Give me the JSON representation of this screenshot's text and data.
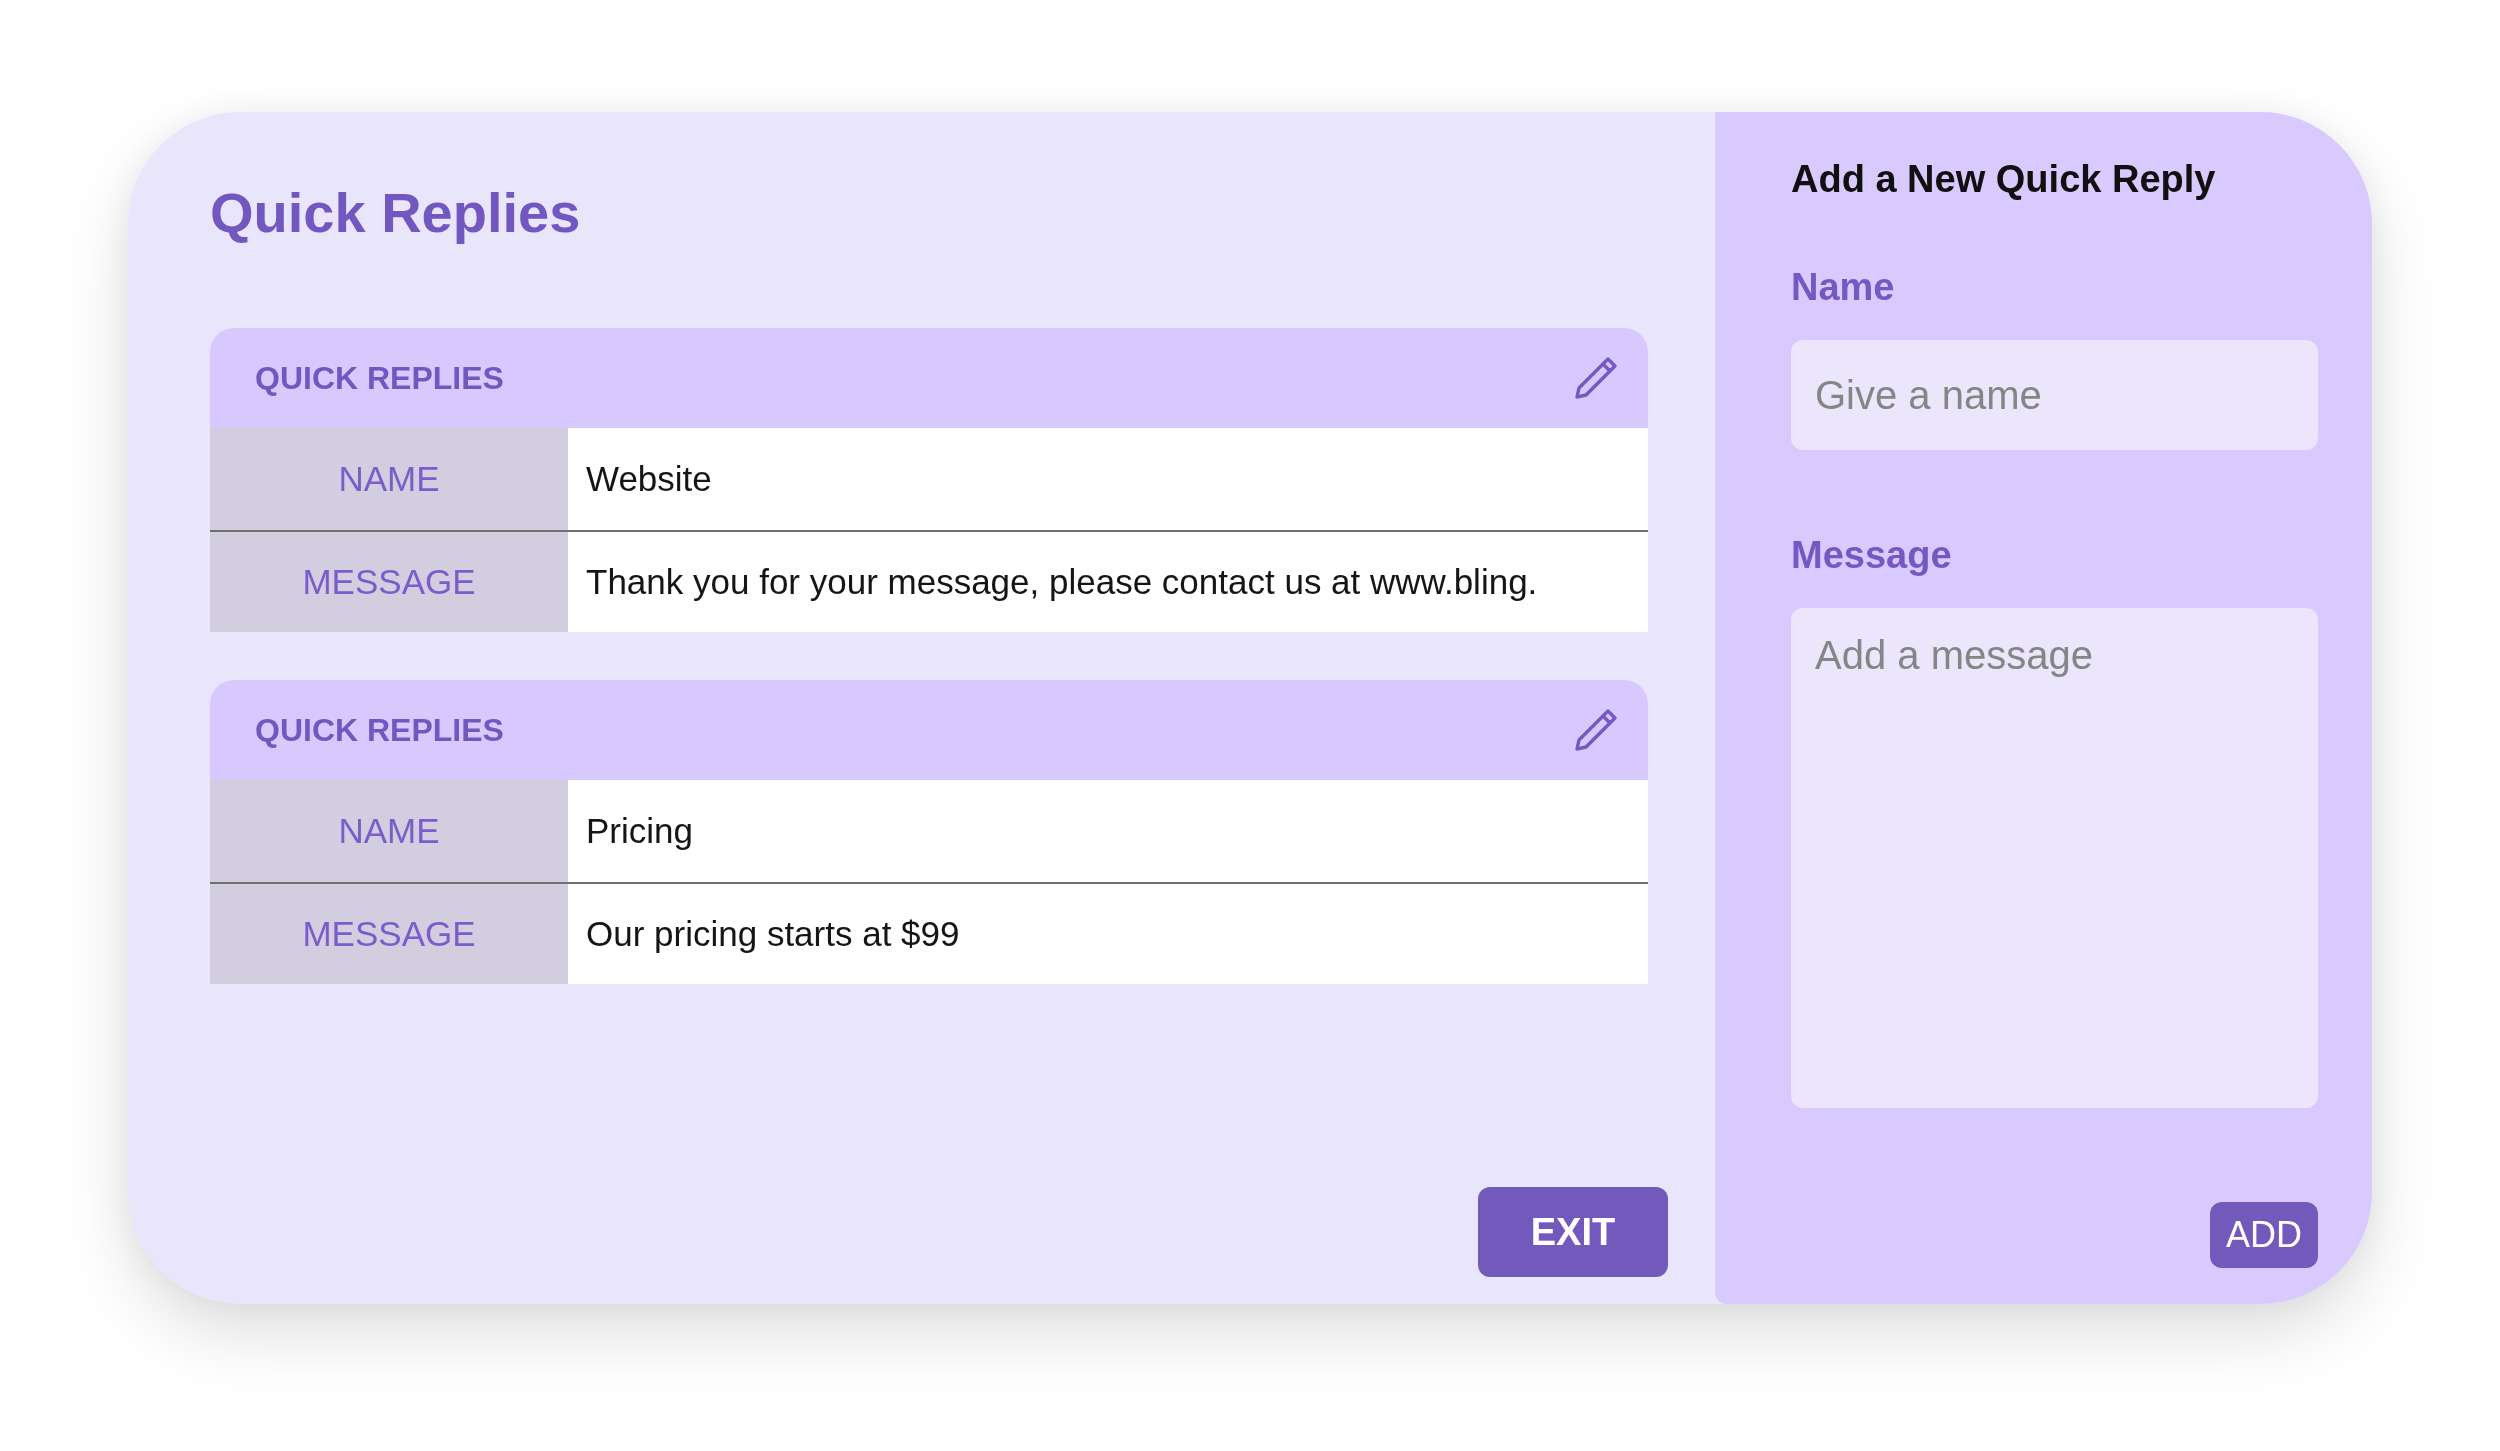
{
  "title": "Quick Replies",
  "replies": [
    {
      "header": "QUICK REPLIES",
      "fields": [
        {
          "label": "NAME",
          "value": "Website"
        },
        {
          "label": "MESSAGE",
          "value": "Thank you for your message, please contact us at www.bling."
        }
      ]
    },
    {
      "header": "QUICK REPLIES",
      "fields": [
        {
          "label": "NAME",
          "value": "Pricing"
        },
        {
          "label": "MESSAGE",
          "value": "Our pricing starts at $99"
        }
      ]
    }
  ],
  "exit_button": "EXIT",
  "form": {
    "title": "Add a New Quick Reply",
    "fields": [
      {
        "kind": "input",
        "label": "Name",
        "placeholder": "Give a name"
      },
      {
        "kind": "textarea",
        "label": "Message",
        "placeholder": "Add a message"
      }
    ],
    "button": "ADD"
  }
}
